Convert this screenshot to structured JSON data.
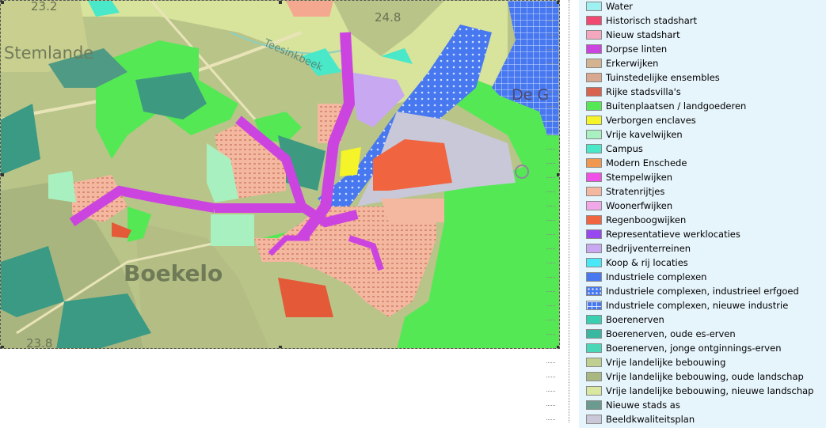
{
  "map": {
    "place_labels": {
      "boekelo": "Boekelo",
      "stemlande": "Stemlande",
      "de_g": "De G",
      "teesinkbeek": "Teesinkbeek",
      "h232": "23.2",
      "h248": "24.8",
      "h238": "23.8"
    }
  },
  "legend": {
    "items": [
      {
        "label": "Water",
        "color": "#9ff0f0",
        "pattern": "solid"
      },
      {
        "label": "Historisch stadshart",
        "color": "#f04870",
        "pattern": "solid"
      },
      {
        "label": "Nieuw stadshart",
        "color": "#f4a8c0",
        "pattern": "solid"
      },
      {
        "label": "Dorpse linten",
        "color": "#cc44e0",
        "pattern": "solid"
      },
      {
        "label": "Erkerwijken",
        "color": "#d4b490",
        "pattern": "solid"
      },
      {
        "label": "Tuinstedelijke ensembles",
        "color": "#d8a890",
        "pattern": "solid"
      },
      {
        "label": "Rijke stadsvilla's",
        "color": "#d86450",
        "pattern": "solid"
      },
      {
        "label": "Buitenplaatsen / landgoederen",
        "color": "#55e855",
        "pattern": "solid"
      },
      {
        "label": "Verborgen enclaves",
        "color": "#f4f428",
        "pattern": "solid"
      },
      {
        "label": "Vrije kavelwijken",
        "color": "#a8f0c0",
        "pattern": "solid"
      },
      {
        "label": "Campus",
        "color": "#48e8c8",
        "pattern": "solid"
      },
      {
        "label": "Modern Enschede",
        "color": "#f09850",
        "pattern": "solid"
      },
      {
        "label": "Stempelwijken",
        "color": "#f050e8",
        "pattern": "solid"
      },
      {
        "label": "Stratenrijtjes",
        "color": "#f4b8a0",
        "pattern": "solid"
      },
      {
        "label": "Woonerfwijken",
        "color": "#f0a8e8",
        "pattern": "solid"
      },
      {
        "label": "Regenboogwijken",
        "color": "#f06440",
        "pattern": "solid"
      },
      {
        "label": "Representatieve werklocaties",
        "color": "#9848f0",
        "pattern": "solid"
      },
      {
        "label": "Bedrijventerreinen",
        "color": "#c8a8f0",
        "pattern": "solid"
      },
      {
        "label": "Koop & rij locaties",
        "color": "#48e8f8",
        "pattern": "solid"
      },
      {
        "label": "Industriele complexen",
        "color": "#4878f0",
        "pattern": "solid"
      },
      {
        "label": "Industriele complexen, industrieel erfgoed",
        "color": "#4878f0",
        "pattern": "dots"
      },
      {
        "label": "Industriele complexen, nieuwe industrie",
        "color": "#4878f0",
        "pattern": "grid"
      },
      {
        "label": "Boerenerven",
        "color": "#38d0b0",
        "pattern": "solid"
      },
      {
        "label": "Boerenerven, oude es-erven",
        "color": "#38b8a0",
        "pattern": "solid"
      },
      {
        "label": "Boerenerven, jonge ontginnings-erven",
        "color": "#48d8b8",
        "pattern": "solid"
      },
      {
        "label": "Vrije landelijke bebouwing",
        "color": "#c0d090",
        "pattern": "solid"
      },
      {
        "label": "Vrije landelijke bebouwing, oude landschap",
        "color": "#a8b880",
        "pattern": "solid"
      },
      {
        "label": "Vrije landelijke bebouwing, nieuwe landschap",
        "color": "#d8e8a0",
        "pattern": "solid"
      },
      {
        "label": "Nieuwe stads as",
        "color": "#6a9a90",
        "pattern": "solid"
      },
      {
        "label": "Beeldkwaliteitsplan",
        "color": "#c8c8d8",
        "pattern": "solid"
      }
    ]
  }
}
